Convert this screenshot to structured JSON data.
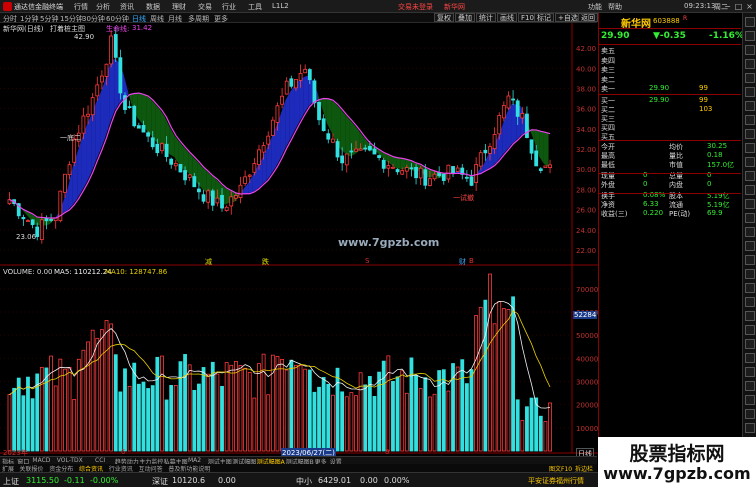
{
  "window": {
    "app_title": "通达信金融终端",
    "menu": [
      "行情",
      "分析",
      "资讯",
      "数据",
      "理财",
      "交易",
      "行业",
      "工具",
      "L1L2"
    ],
    "center_title": "交易未登录",
    "center_link": "新华网",
    "right_menu": [
      "功能",
      "帮助"
    ],
    "clock": "09:23:13",
    "weekday": "周二",
    "controls": [
      "−",
      "□",
      "×"
    ]
  },
  "toolbar": {
    "periods": [
      "分时",
      "1分钟",
      "5分钟",
      "15分钟",
      "30分钟",
      "60分钟",
      "日线",
      "周线",
      "月线",
      "多周期",
      "更多"
    ],
    "active_period": "日线",
    "right_buttons": [
      "复权",
      "叠加",
      "统计",
      "画线",
      "F10",
      "标记",
      "+自选",
      "返回"
    ]
  },
  "chart": {
    "stock_label": "新华网(日线)",
    "indicator_name": "打着桩主图",
    "indicator_field": "生命线:",
    "indicator_value": "31.42",
    "high_label": "42.90",
    "low_label": "23.06",
    "buy_label": "一底二",
    "sell_label": "一试撤",
    "y_axis_price": [
      "42.00",
      "40.00",
      "38.00",
      "36.00",
      "34.00",
      "32.00",
      "30.00",
      "28.00",
      "26.00",
      "24.00",
      "22.00"
    ],
    "signals": [
      {
        "text": "减",
        "color": "#e0e000"
      },
      {
        "text": "跌",
        "color": "#e0e000"
      },
      {
        "text": "S",
        "color": "#e03030"
      },
      {
        "text": "财",
        "color": "#33aaff"
      },
      {
        "text": "B",
        "color": "#e03030"
      }
    ],
    "volume_title": "VOLUME: 0.00",
    "ma5_label": "MA5: 110212.24",
    "ma10_label": "MA10: 128747.86",
    "y_axis_volume": [
      "70000",
      "60000",
      "50000",
      "40000",
      "30000",
      "20000",
      "10000"
    ],
    "volume_highlight": "52284",
    "x_labels": [
      "2023年",
      "6",
      "2023/06/27(二)",
      "8"
    ],
    "period_badge": "日线",
    "site_mark": "www.7gpzb.com",
    "colors": {
      "up": "#ff3b3b",
      "down": "#33e0e0",
      "ma5": "#f2f2f2",
      "ma10": "#e8d000",
      "lifeline": "#ee44ee",
      "band_up": "#2233dd",
      "band_down": "#116611"
    }
  },
  "quote": {
    "name": "新华网",
    "code": "603888",
    "badge": "R",
    "price": "29.90",
    "change": "▼-0.35",
    "pct": "-1.16%",
    "asks": [
      {
        "label": "卖五",
        "price": "",
        "vol": ""
      },
      {
        "label": "卖四",
        "price": "",
        "vol": ""
      },
      {
        "label": "卖三",
        "price": "",
        "vol": ""
      },
      {
        "label": "卖二",
        "price": "",
        "vol": ""
      },
      {
        "label": "卖一",
        "price": "29.90",
        "vol": "99"
      }
    ],
    "bids": [
      {
        "label": "买一",
        "price": "29.90",
        "vol": "99"
      },
      {
        "label": "买二",
        "price": "",
        "vol": "103"
      },
      {
        "label": "买三",
        "price": "",
        "vol": ""
      },
      {
        "label": "买四",
        "price": "",
        "vol": ""
      },
      {
        "label": "买五",
        "price": "",
        "vol": ""
      }
    ],
    "stats": [
      {
        "l1": "今开",
        "v1": "",
        "l2": "均价",
        "v2": "30.25"
      },
      {
        "l1": "最高",
        "v1": "",
        "l2": "量比",
        "v2": "0.18"
      },
      {
        "l1": "最低",
        "v1": "",
        "l2": "市值",
        "v2": "157.0亿"
      },
      {
        "l1": "现量",
        "v1": "0",
        "l2": "总量",
        "v2": "0"
      },
      {
        "l1": "外盘",
        "v1": "0",
        "l2": "内盘",
        "v2": "0"
      },
      {
        "l1": "换手",
        "v1": "0.08%",
        "l2": "股本",
        "v2": "5.19亿"
      },
      {
        "l1": "净资",
        "v1": "6.33",
        "l2": "流通",
        "v2": "5.19亿"
      },
      {
        "l1": "收益(三)",
        "v1": "0.220",
        "l2": "PE(动)",
        "v2": "69.9"
      }
    ]
  },
  "bottom": {
    "tabs": [
      "指标",
      "窗口",
      "MACD",
      "VOL-TDX",
      "CCI",
      "趋势动力",
      "主力监控",
      "私募主图",
      "MA2",
      "测试主图",
      "测试幅图",
      "测试幅图A",
      "测试幅图B",
      "更多",
      "设置"
    ],
    "active_tab": "测试幅图A",
    "ind_tabs": [
      "扩展",
      "关联报价",
      "资金分布",
      "综合资讯",
      "行业资讯",
      "互动问答",
      "普及新功能说明"
    ],
    "active_ind_tab": "综合资讯",
    "right_links": [
      "图文F10",
      "拆边栏"
    ]
  },
  "status": {
    "idx1_name": "上证",
    "idx1_val": "3115.50",
    "idx1_chg": "-0.11",
    "idx1_pct": "-0.00%",
    "idx2_name": "深证",
    "idx2_val": "10120.6",
    "idx2_chg": "0.00",
    "idx3_name": "中小",
    "idx3_val": "6429.01",
    "idx3_chg": "0.00",
    "idx3_pct": "0.00%",
    "broker": "平安证券福州行情"
  },
  "watermark": {
    "line1": "股票指标网",
    "line2": "www.7gpzb.com"
  }
}
